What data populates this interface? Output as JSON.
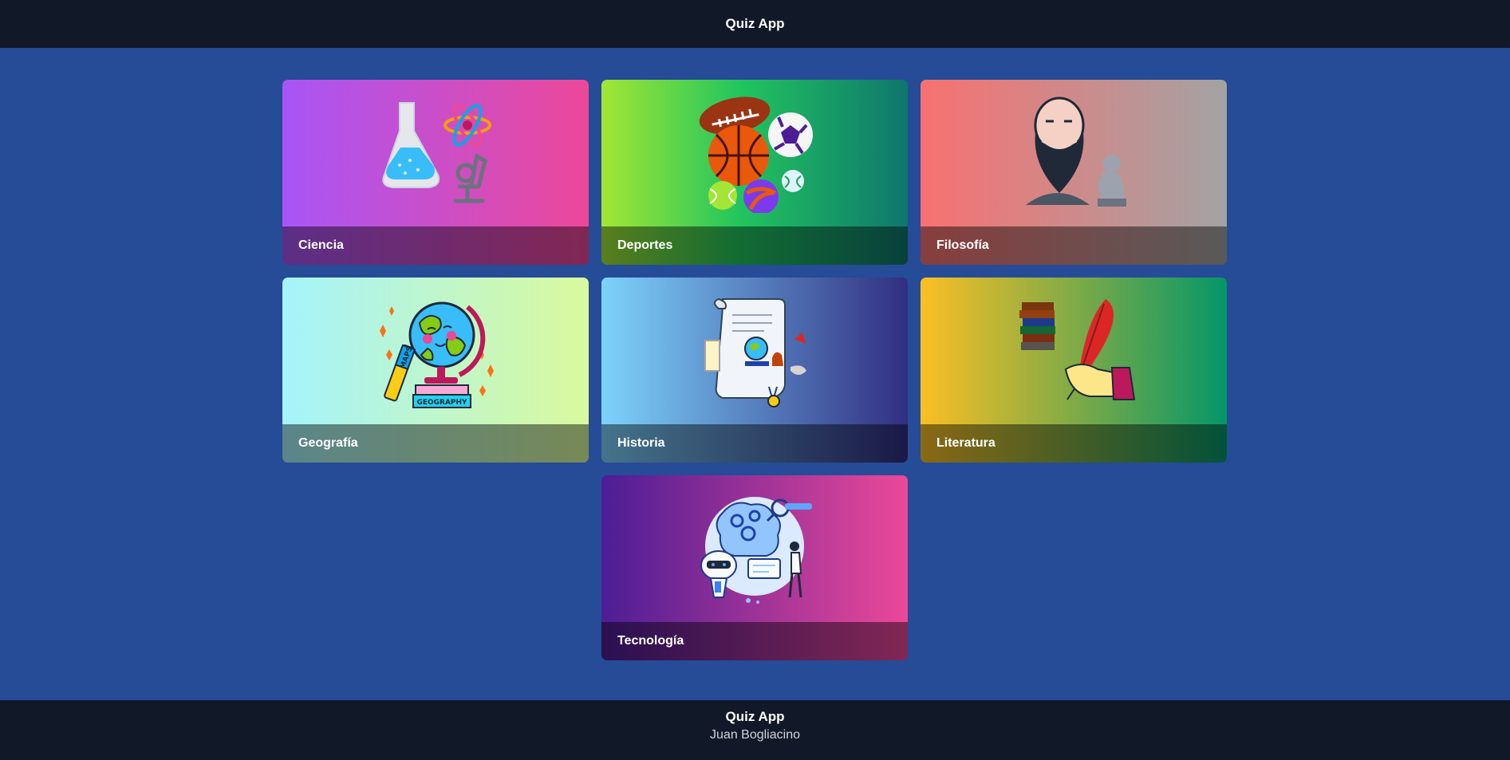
{
  "header": {
    "title": "Quiz App"
  },
  "categories": [
    {
      "label": "Ciencia",
      "icon": "science-flask-atom-icon"
    },
    {
      "label": "Deportes",
      "icon": "sports-balls-icon"
    },
    {
      "label": "Filosofía",
      "icon": "philosopher-bust-icon"
    },
    {
      "label": "Geografía",
      "icon": "globe-books-icon",
      "art_text": [
        "MAPS",
        "GEOGRAPHY"
      ]
    },
    {
      "label": "Historia",
      "icon": "scroll-history-icon"
    },
    {
      "label": "Literatura",
      "icon": "quill-books-icon"
    },
    {
      "label": "Tecnología",
      "icon": "technology-robot-icon"
    }
  ],
  "footer": {
    "title": "Quiz App",
    "author": "Juan Bogliacino"
  },
  "colors": {
    "page_bg": "#264b97",
    "bar_bg": "#111827"
  }
}
